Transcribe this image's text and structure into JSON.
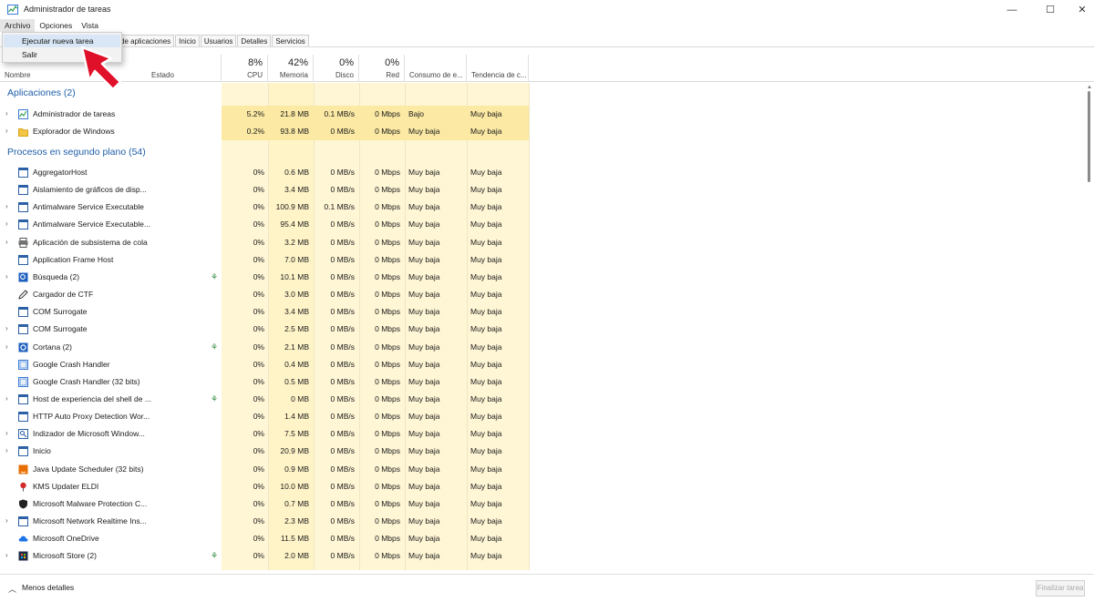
{
  "window": {
    "title": "Administrador de tareas",
    "minimize_glyph": "—",
    "maximize_glyph": "☐",
    "close_glyph": "✕"
  },
  "menu": [
    "Archivo",
    "Opciones",
    "Vista"
  ],
  "file_menu": {
    "run_task": "Ejecutar nueva tarea",
    "exit": "Salir"
  },
  "tabs": [
    "de aplicaciones",
    "Inicio",
    "Usuarios",
    "Detalles",
    "Servicios"
  ],
  "columns": {
    "name": "Nombre",
    "status": "Estado",
    "cpu": {
      "percent": "8%",
      "label": "CPU"
    },
    "memory": {
      "percent": "42%",
      "label": "Memoria"
    },
    "disk": {
      "percent": "0%",
      "label": "Disco"
    },
    "network": {
      "percent": "0%",
      "label": "Red"
    },
    "power": "Consumo de e...",
    "power_trend": "Tendencia de c..."
  },
  "groups": {
    "apps": "Aplicaciones (2)",
    "background": "Procesos en segundo plano (54)"
  },
  "apps": [
    {
      "name": "Administrador de tareas",
      "icon": "task-manager-icon",
      "expandable": true,
      "cpu": "5.2%",
      "mem": "21.8 MB",
      "disk": "0.1 MB/s",
      "net": "0 Mbps",
      "power": "Bajo",
      "trend": "Muy baja",
      "highlight": true
    },
    {
      "name": "Explorador de Windows",
      "icon": "folder-icon",
      "expandable": true,
      "cpu": "0.2%",
      "mem": "93.8 MB",
      "disk": "0 MB/s",
      "net": "0 Mbps",
      "power": "Muy baja",
      "trend": "Muy baja",
      "highlight": true
    }
  ],
  "processes": [
    {
      "name": "AggregatorHost",
      "icon": "window-icon",
      "expandable": false,
      "suspended": false,
      "cpu": "0%",
      "mem": "0.6 MB",
      "disk": "0 MB/s",
      "net": "0 Mbps",
      "power": "Muy baja",
      "trend": "Muy baja"
    },
    {
      "name": "Aislamiento de gráficos de disp...",
      "icon": "window-icon",
      "expandable": false,
      "suspended": false,
      "cpu": "0%",
      "mem": "3.4 MB",
      "disk": "0 MB/s",
      "net": "0 Mbps",
      "power": "Muy baja",
      "trend": "Muy baja"
    },
    {
      "name": "Antimalware Service Executable",
      "icon": "window-icon",
      "expandable": true,
      "suspended": false,
      "cpu": "0%",
      "mem": "100.9 MB",
      "disk": "0.1 MB/s",
      "net": "0 Mbps",
      "power": "Muy baja",
      "trend": "Muy baja"
    },
    {
      "name": "Antimalware Service Executable...",
      "icon": "window-icon",
      "expandable": true,
      "suspended": false,
      "cpu": "0%",
      "mem": "95.4 MB",
      "disk": "0 MB/s",
      "net": "0 Mbps",
      "power": "Muy baja",
      "trend": "Muy baja"
    },
    {
      "name": "Aplicación de subsistema de cola",
      "icon": "printer-icon",
      "expandable": true,
      "suspended": false,
      "cpu": "0%",
      "mem": "3.2 MB",
      "disk": "0 MB/s",
      "net": "0 Mbps",
      "power": "Muy baja",
      "trend": "Muy baja"
    },
    {
      "name": "Application Frame Host",
      "icon": "window-icon",
      "expandable": false,
      "suspended": false,
      "cpu": "0%",
      "mem": "7.0 MB",
      "disk": "0 MB/s",
      "net": "0 Mbps",
      "power": "Muy baja",
      "trend": "Muy baja"
    },
    {
      "name": "Búsqueda (2)",
      "icon": "search-app-icon",
      "expandable": true,
      "suspended": true,
      "cpu": "0%",
      "mem": "10.1 MB",
      "disk": "0 MB/s",
      "net": "0 Mbps",
      "power": "Muy baja",
      "trend": "Muy baja"
    },
    {
      "name": "Cargador de CTF",
      "icon": "pen-icon",
      "expandable": false,
      "suspended": false,
      "cpu": "0%",
      "mem": "3.0 MB",
      "disk": "0 MB/s",
      "net": "0 Mbps",
      "power": "Muy baja",
      "trend": "Muy baja"
    },
    {
      "name": "COM Surrogate",
      "icon": "window-icon",
      "expandable": false,
      "suspended": false,
      "cpu": "0%",
      "mem": "3.4 MB",
      "disk": "0 MB/s",
      "net": "0 Mbps",
      "power": "Muy baja",
      "trend": "Muy baja"
    },
    {
      "name": "COM Surrogate",
      "icon": "window-icon",
      "expandable": true,
      "suspended": false,
      "cpu": "0%",
      "mem": "2.5 MB",
      "disk": "0 MB/s",
      "net": "0 Mbps",
      "power": "Muy baja",
      "trend": "Muy baja"
    },
    {
      "name": "Cortana (2)",
      "icon": "cortana-icon",
      "expandable": true,
      "suspended": true,
      "cpu": "0%",
      "mem": "2.1 MB",
      "disk": "0 MB/s",
      "net": "0 Mbps",
      "power": "Muy baja",
      "trend": "Muy baja"
    },
    {
      "name": "Google Crash Handler",
      "icon": "google-icon",
      "expandable": false,
      "suspended": false,
      "cpu": "0%",
      "mem": "0.4 MB",
      "disk": "0 MB/s",
      "net": "0 Mbps",
      "power": "Muy baja",
      "trend": "Muy baja"
    },
    {
      "name": "Google Crash Handler (32 bits)",
      "icon": "google-icon",
      "expandable": false,
      "suspended": false,
      "cpu": "0%",
      "mem": "0.5 MB",
      "disk": "0 MB/s",
      "net": "0 Mbps",
      "power": "Muy baja",
      "trend": "Muy baja"
    },
    {
      "name": "Host de experiencia del shell de ...",
      "icon": "window-icon",
      "expandable": true,
      "suspended": true,
      "cpu": "0%",
      "mem": "0 MB",
      "disk": "0 MB/s",
      "net": "0 Mbps",
      "power": "Muy baja",
      "trend": "Muy baja"
    },
    {
      "name": "HTTP Auto Proxy Detection Wor...",
      "icon": "window-icon",
      "expandable": false,
      "suspended": false,
      "cpu": "0%",
      "mem": "1.4 MB",
      "disk": "0 MB/s",
      "net": "0 Mbps",
      "power": "Muy baja",
      "trend": "Muy baja"
    },
    {
      "name": "Indizador de Microsoft Window...",
      "icon": "indexer-icon",
      "expandable": true,
      "suspended": false,
      "cpu": "0%",
      "mem": "7.5 MB",
      "disk": "0 MB/s",
      "net": "0 Mbps",
      "power": "Muy baja",
      "trend": "Muy baja"
    },
    {
      "name": "Inicio",
      "icon": "window-icon",
      "expandable": true,
      "suspended": false,
      "cpu": "0%",
      "mem": "20.9 MB",
      "disk": "0 MB/s",
      "net": "0 Mbps",
      "power": "Muy baja",
      "trend": "Muy baja"
    },
    {
      "name": "Java Update Scheduler (32 bits)",
      "icon": "java-icon",
      "expandable": false,
      "suspended": false,
      "cpu": "0%",
      "mem": "0.9 MB",
      "disk": "0 MB/s",
      "net": "0 Mbps",
      "power": "Muy baja",
      "trend": "Muy baja"
    },
    {
      "name": "KMS Updater ELDI",
      "icon": "pin-icon",
      "expandable": false,
      "suspended": false,
      "cpu": "0%",
      "mem": "10.0 MB",
      "disk": "0 MB/s",
      "net": "0 Mbps",
      "power": "Muy baja",
      "trend": "Muy baja"
    },
    {
      "name": "Microsoft Malware Protection C...",
      "icon": "shield-icon",
      "expandable": false,
      "suspended": false,
      "cpu": "0%",
      "mem": "0.7 MB",
      "disk": "0 MB/s",
      "net": "0 Mbps",
      "power": "Muy baja",
      "trend": "Muy baja"
    },
    {
      "name": "Microsoft Network Realtime Ins...",
      "icon": "window-icon",
      "expandable": true,
      "suspended": false,
      "cpu": "0%",
      "mem": "2.3 MB",
      "disk": "0 MB/s",
      "net": "0 Mbps",
      "power": "Muy baja",
      "trend": "Muy baja"
    },
    {
      "name": "Microsoft OneDrive",
      "icon": "cloud-icon",
      "expandable": false,
      "suspended": false,
      "cpu": "0%",
      "mem": "11.5 MB",
      "disk": "0 MB/s",
      "net": "0 Mbps",
      "power": "Muy baja",
      "trend": "Muy baja"
    },
    {
      "name": "Microsoft Store (2)",
      "icon": "store-icon",
      "expandable": true,
      "suspended": true,
      "cpu": "0%",
      "mem": "2.0 MB",
      "disk": "0 MB/s",
      "net": "0 Mbps",
      "power": "Muy baja",
      "trend": "Muy baja"
    }
  ],
  "footer": {
    "fewer_details": "Menos detalles",
    "end_task": "Finalizar tarea"
  },
  "colors": {
    "group_heading": "#1f5fa8",
    "heat_light": "#fff6d5",
    "heat_highlight": "#fbe9a4",
    "menu_highlight": "#d8e6f5",
    "arrow": "#e0102a"
  }
}
